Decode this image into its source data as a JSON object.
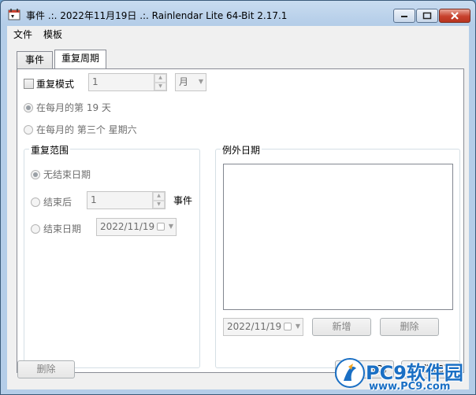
{
  "window": {
    "title": "事件 .:. 2022年11月19日 .:. Rainlendar Lite 64-Bit 2.17.1"
  },
  "menu": {
    "items": [
      "文件",
      "模板"
    ]
  },
  "tabs": [
    {
      "label": "事件",
      "active": false
    },
    {
      "label": "重复周期",
      "active": true
    }
  ],
  "repeat": {
    "mode_label": "重复模式",
    "interval_value": "1",
    "unit_value": "月",
    "option_day_label": "在每月的第 19 天",
    "option_weekday_label": "在每月的 第三个 星期六"
  },
  "range": {
    "title": "重复范围",
    "no_end_label": "无结束日期",
    "end_after_label": "结束后",
    "end_after_value": "1",
    "end_after_unit": "事件",
    "end_date_label": "结束日期",
    "end_date_value": "2022/11/19"
  },
  "exceptions": {
    "title": "例外日期",
    "date_value": "2022/11/19",
    "add_label": "新增",
    "delete_label": "删除"
  },
  "footer": {
    "delete_label": "删除",
    "ok_partial": "(O)",
    "cancel_partial": "取消(C)"
  },
  "watermark": {
    "brand": "PC9软件园",
    "url": "www.PC9.com"
  },
  "colors": {
    "titlebar": "#b4cde8",
    "panel": "#ffffff",
    "client": "#f0f0f0",
    "disabled_text": "#6d6d6d",
    "watermark_blue": "#1a6fc4"
  }
}
